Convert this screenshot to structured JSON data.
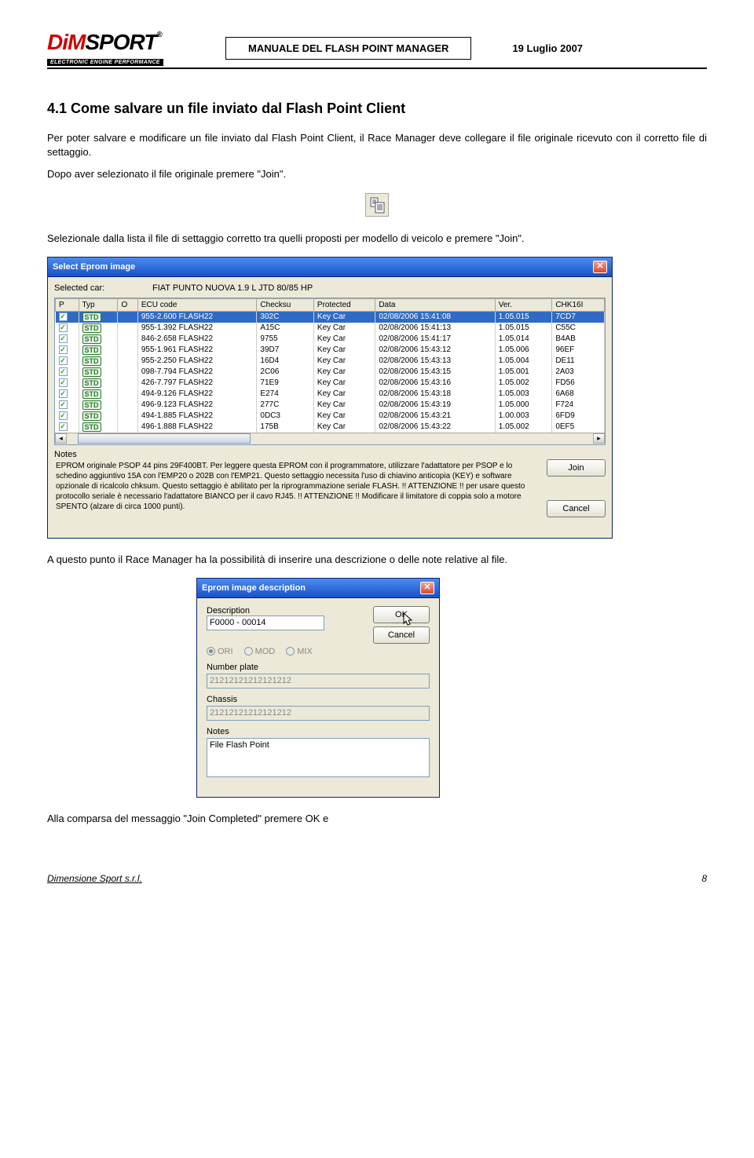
{
  "header": {
    "logo_main_1": "D",
    "logo_main_2": "i",
    "logo_main_3": "M",
    "logo_main_4": "SPORT",
    "logo_r": "®",
    "logo_sub": "ELECTRONIC ENGINE PERFORMANCE",
    "title": "MANUALE DEL FLASH POINT MANAGER",
    "date": "19 Luglio 2007"
  },
  "section": {
    "title": "4.1 Come salvare un file inviato dal Flash Point Client",
    "para1": "Per poter salvare e modificare un file inviato dal Flash Point Client, il Race Manager deve collegare il file originale ricevuto con il corretto file di settaggio.",
    "para2": "Dopo aver selezionato il file originale premere \"Join\".",
    "para3": "Selezionale dalla lista il file di settaggio corretto tra quelli proposti per modello di veicolo e premere \"Join\".",
    "para4": "A questo punto il Race Manager ha la possibilità di inserire una descrizione o delle note relative al file.",
    "para5": "Alla comparsa del messaggio \"Join Completed\" premere OK e"
  },
  "dialog1": {
    "title": "Select Eprom image",
    "selected_car_label": "Selected car:",
    "selected_car_value": "FIAT PUNTO NUOVA 1.9 L JTD 80/85 HP",
    "columns": [
      "P",
      "Typ",
      "O",
      "ECU code",
      "Checksu",
      "Protected",
      "Data",
      "Ver.",
      "CHK16I"
    ],
    "rows": [
      {
        "p": true,
        "typ": "STD",
        "o": "",
        "ecu": "955-2.600 FLASH22",
        "chk": "302C",
        "prot": "Key Car",
        "data": "02/08/2006 15:41:08",
        "ver": "1.05.015",
        "chk16": "7CD7",
        "sel": true
      },
      {
        "p": true,
        "typ": "STD",
        "o": "",
        "ecu": "955-1.392 FLASH22",
        "chk": "A15C",
        "prot": "Key Car",
        "data": "02/08/2006 15:41:13",
        "ver": "1.05.015",
        "chk16": "C55C"
      },
      {
        "p": true,
        "typ": "STD",
        "o": "",
        "ecu": "846-2.658 FLASH22",
        "chk": "9755",
        "prot": "Key Car",
        "data": "02/08/2006 15:41:17",
        "ver": "1.05.014",
        "chk16": "B4AB"
      },
      {
        "p": true,
        "typ": "STD",
        "o": "",
        "ecu": "955-1.961 FLASH22",
        "chk": "39D7",
        "prot": "Key Car",
        "data": "02/08/2006 15:43:12",
        "ver": "1.05.006",
        "chk16": "96EF"
      },
      {
        "p": true,
        "typ": "STD",
        "o": "",
        "ecu": "955-2.250 FLASH22",
        "chk": "16D4",
        "prot": "Key Car",
        "data": "02/08/2006 15:43:13",
        "ver": "1.05.004",
        "chk16": "DE11"
      },
      {
        "p": true,
        "typ": "STD",
        "o": "",
        "ecu": "098-7.794 FLASH22",
        "chk": "2C06",
        "prot": "Key Car",
        "data": "02/08/2006 15:43:15",
        "ver": "1.05.001",
        "chk16": "2A03"
      },
      {
        "p": true,
        "typ": "STD",
        "o": "",
        "ecu": "426-7.797 FLASH22",
        "chk": "71E9",
        "prot": "Key Car",
        "data": "02/08/2006 15:43:16",
        "ver": "1.05.002",
        "chk16": "FD56"
      },
      {
        "p": true,
        "typ": "STD",
        "o": "",
        "ecu": "494-9.126 FLASH22",
        "chk": "E274",
        "prot": "Key Car",
        "data": "02/08/2006 15:43:18",
        "ver": "1.05.003",
        "chk16": "6A68"
      },
      {
        "p": true,
        "typ": "STD",
        "o": "",
        "ecu": "496-9.123 FLASH22",
        "chk": "277C",
        "prot": "Key Car",
        "data": "02/08/2006 15:43:19",
        "ver": "1.05.000",
        "chk16": "F724"
      },
      {
        "p": true,
        "typ": "STD",
        "o": "",
        "ecu": "494-1.885 FLASH22",
        "chk": "0DC3",
        "prot": "Key Car",
        "data": "02/08/2006 15:43:21",
        "ver": "1.00.003",
        "chk16": "6FD9"
      },
      {
        "p": true,
        "typ": "STD",
        "o": "",
        "ecu": "496-1.888 FLASH22",
        "chk": "175B",
        "prot": "Key Car",
        "data": "02/08/2006 15:43:22",
        "ver": "1.05.002",
        "chk16": "0EF5"
      }
    ],
    "notes_label": "Notes",
    "notes_text": "EPROM originale PSOP 44 pins 29F400BT. Per leggere questa EPROM con il programmatore, utilizzare l'adattatore per PSOP e lo schedino aggiuntivo 15A con l'EMP20 o 202B con l'EMP21. Questo settaggio necessita l'uso di chiavino anticopia (KEY) e software opzionale di ricalcolo chksum. Questo settaggio è abilitato per la riprogrammazione seriale FLASH. !! ATTENZIONE !! per usare questo protocollo seriale è necessario l'adattatore BIANCO per il cavo RJ45. !! ATTENZIONE !! Modificare il limitatore di coppia solo a motore SPENTO (alzare di circa 1000 punti).",
    "join_btn": "Join",
    "cancel_btn": "Cancel"
  },
  "dialog2": {
    "title": "Eprom image description",
    "description_label": "Description",
    "description_value": "F0000 - 00014",
    "ok_btn": "OK",
    "cancel_btn": "Cancel",
    "radio_ori": "ORI",
    "radio_mod": "MOD",
    "radio_mix": "MIX",
    "numberplate_label": "Number plate",
    "numberplate_value": "21212121212121212",
    "chassis_label": "Chassis",
    "chassis_value": "21212121212121212",
    "notes_label": "Notes",
    "notes_value": "File Flash Point"
  },
  "footer": {
    "company": "Dimensione Sport s.r.l.",
    "page": "8"
  }
}
